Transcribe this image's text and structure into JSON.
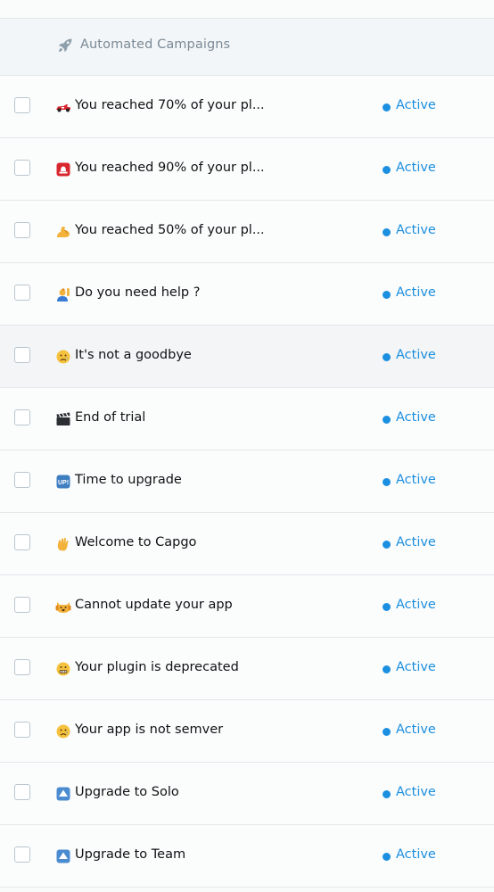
{
  "section": {
    "title": "Automated Campaigns",
    "icon": "rocket-icon"
  },
  "colors": {
    "status_active": "#1b8fe0",
    "text": "#0f1215",
    "muted": "#7b8a96"
  },
  "campaigns": [
    {
      "emoji": "racecar-icon",
      "name": "You reached 70% of your pl...",
      "status": "Active"
    },
    {
      "emoji": "siren-icon",
      "name": "You reached 90% of your pl...",
      "status": "Active"
    },
    {
      "emoji": "flexed-biceps-icon",
      "name": "You reached 50% of your pl...",
      "status": "Active"
    },
    {
      "emoji": "raising-hand-icon",
      "name": "Do you need help ?",
      "status": "Active"
    },
    {
      "emoji": "sad-face-icon",
      "name": "It's not a goodbye",
      "status": "Active"
    },
    {
      "emoji": "clapper-board-icon",
      "name": "End of trial",
      "status": "Active"
    },
    {
      "emoji": "up-button-icon",
      "name": "Time to upgrade",
      "status": "Active"
    },
    {
      "emoji": "waving-hand-icon",
      "name": "Welcome to Capgo",
      "status": "Active"
    },
    {
      "emoji": "weary-cat-icon",
      "name": "Cannot update your app",
      "status": "Active"
    },
    {
      "emoji": "grimacing-face-icon",
      "name": "Your plugin is deprecated",
      "status": "Active"
    },
    {
      "emoji": "sad-face-icon",
      "name": "Your app is not semver",
      "status": "Active"
    },
    {
      "emoji": "up-arrow-icon",
      "name": "Upgrade to Solo",
      "status": "Active"
    },
    {
      "emoji": "up-arrow-icon",
      "name": "Upgrade to Team",
      "status": "Active"
    }
  ]
}
